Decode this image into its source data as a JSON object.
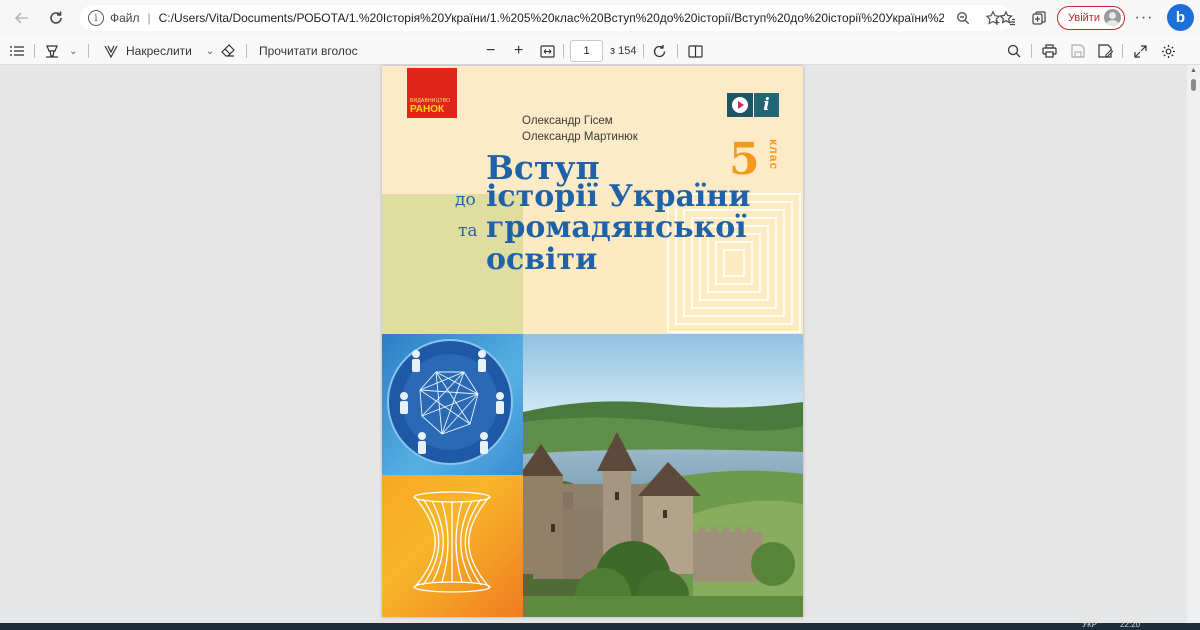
{
  "browser": {
    "back_icon": "arrow-left-icon",
    "reload_icon": "reload-icon",
    "url_scheme_label": "Файл",
    "url": "C:/Users/Vita/Documents/РОБОТА/1.%20Історія%20України/1.%205%20клас%20Вступ%20до%20історії/Вступ%20до%20історії%20України%20та%20гро...",
    "signin_label": "Увійти",
    "bing_label": "b"
  },
  "pdf_toolbar": {
    "draw_label": "Накреслити",
    "read_aloud_label": "Прочитати вголос",
    "page_current": "1",
    "page_total_label": "з 154"
  },
  "cover": {
    "publisher": {
      "small": "ВИДАВНИЦТВО",
      "big": "РАНОК"
    },
    "authors": [
      "Олександр Гісем",
      "Олександр Мартинюк"
    ],
    "title": {
      "line1": "Вступ",
      "line2_prefix": "до",
      "line2": "історії України",
      "line3_prefix": "та",
      "line3": "громадянської",
      "line4": "освіти"
    },
    "grade_number": "5",
    "grade_word": "клас",
    "media_letter": "i"
  },
  "taskbar": {
    "lang": "УКР",
    "time": "22:20"
  },
  "colors": {
    "title_blue": "#1f62a8",
    "grade_orange": "#f39a1d",
    "signin_red": "#c4272b",
    "publisher_red": "#e0251b"
  }
}
